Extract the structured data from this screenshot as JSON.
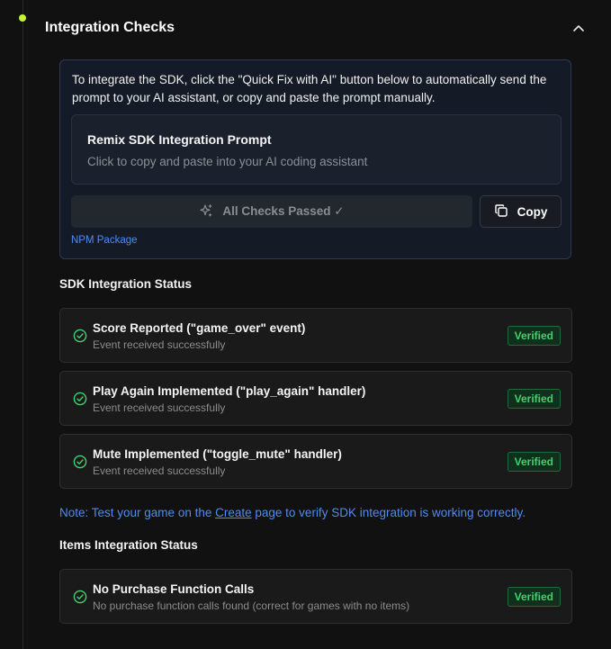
{
  "section": {
    "title": "Integration Checks"
  },
  "info_panel": {
    "text": "To integrate the SDK, click the \"Quick Fix with AI\" button below to automatically send the prompt to your AI assistant, or copy and paste the prompt manually.",
    "prompt_card": {
      "title": "Remix SDK Integration Prompt",
      "subtitle": "Click to copy and paste into your AI coding assistant"
    },
    "quick_fix_button": {
      "label": "All Checks Passed ✓",
      "icon": "sparkles-icon",
      "disabled": true
    },
    "copy_button": {
      "label": "Copy",
      "icon": "copy-icon"
    },
    "npm_link": "NPM Package"
  },
  "sdk_status": {
    "title": "SDK Integration Status",
    "items": [
      {
        "title": "Score Reported (\"game_over\" event)",
        "desc": "Event received successfully",
        "badge": "Verified"
      },
      {
        "title": "Play Again Implemented (\"play_again\" handler)",
        "desc": "Event received successfully",
        "badge": "Verified"
      },
      {
        "title": "Mute Implemented (\"toggle_mute\" handler)",
        "desc": "Event received successfully",
        "badge": "Verified"
      }
    ]
  },
  "note": {
    "prefix": "Note: Test your game on the ",
    "link": "Create",
    "suffix": " page to verify SDK integration is working correctly."
  },
  "items_status": {
    "title": "Items Integration Status",
    "items": [
      {
        "title": "No Purchase Function Calls",
        "desc": "No purchase function calls found (correct for games with no items)",
        "badge": "Verified"
      }
    ]
  },
  "colors": {
    "accent_dot": "#c6f432",
    "link_blue": "#4f8bf0",
    "verified_green": "#3fd26e"
  }
}
